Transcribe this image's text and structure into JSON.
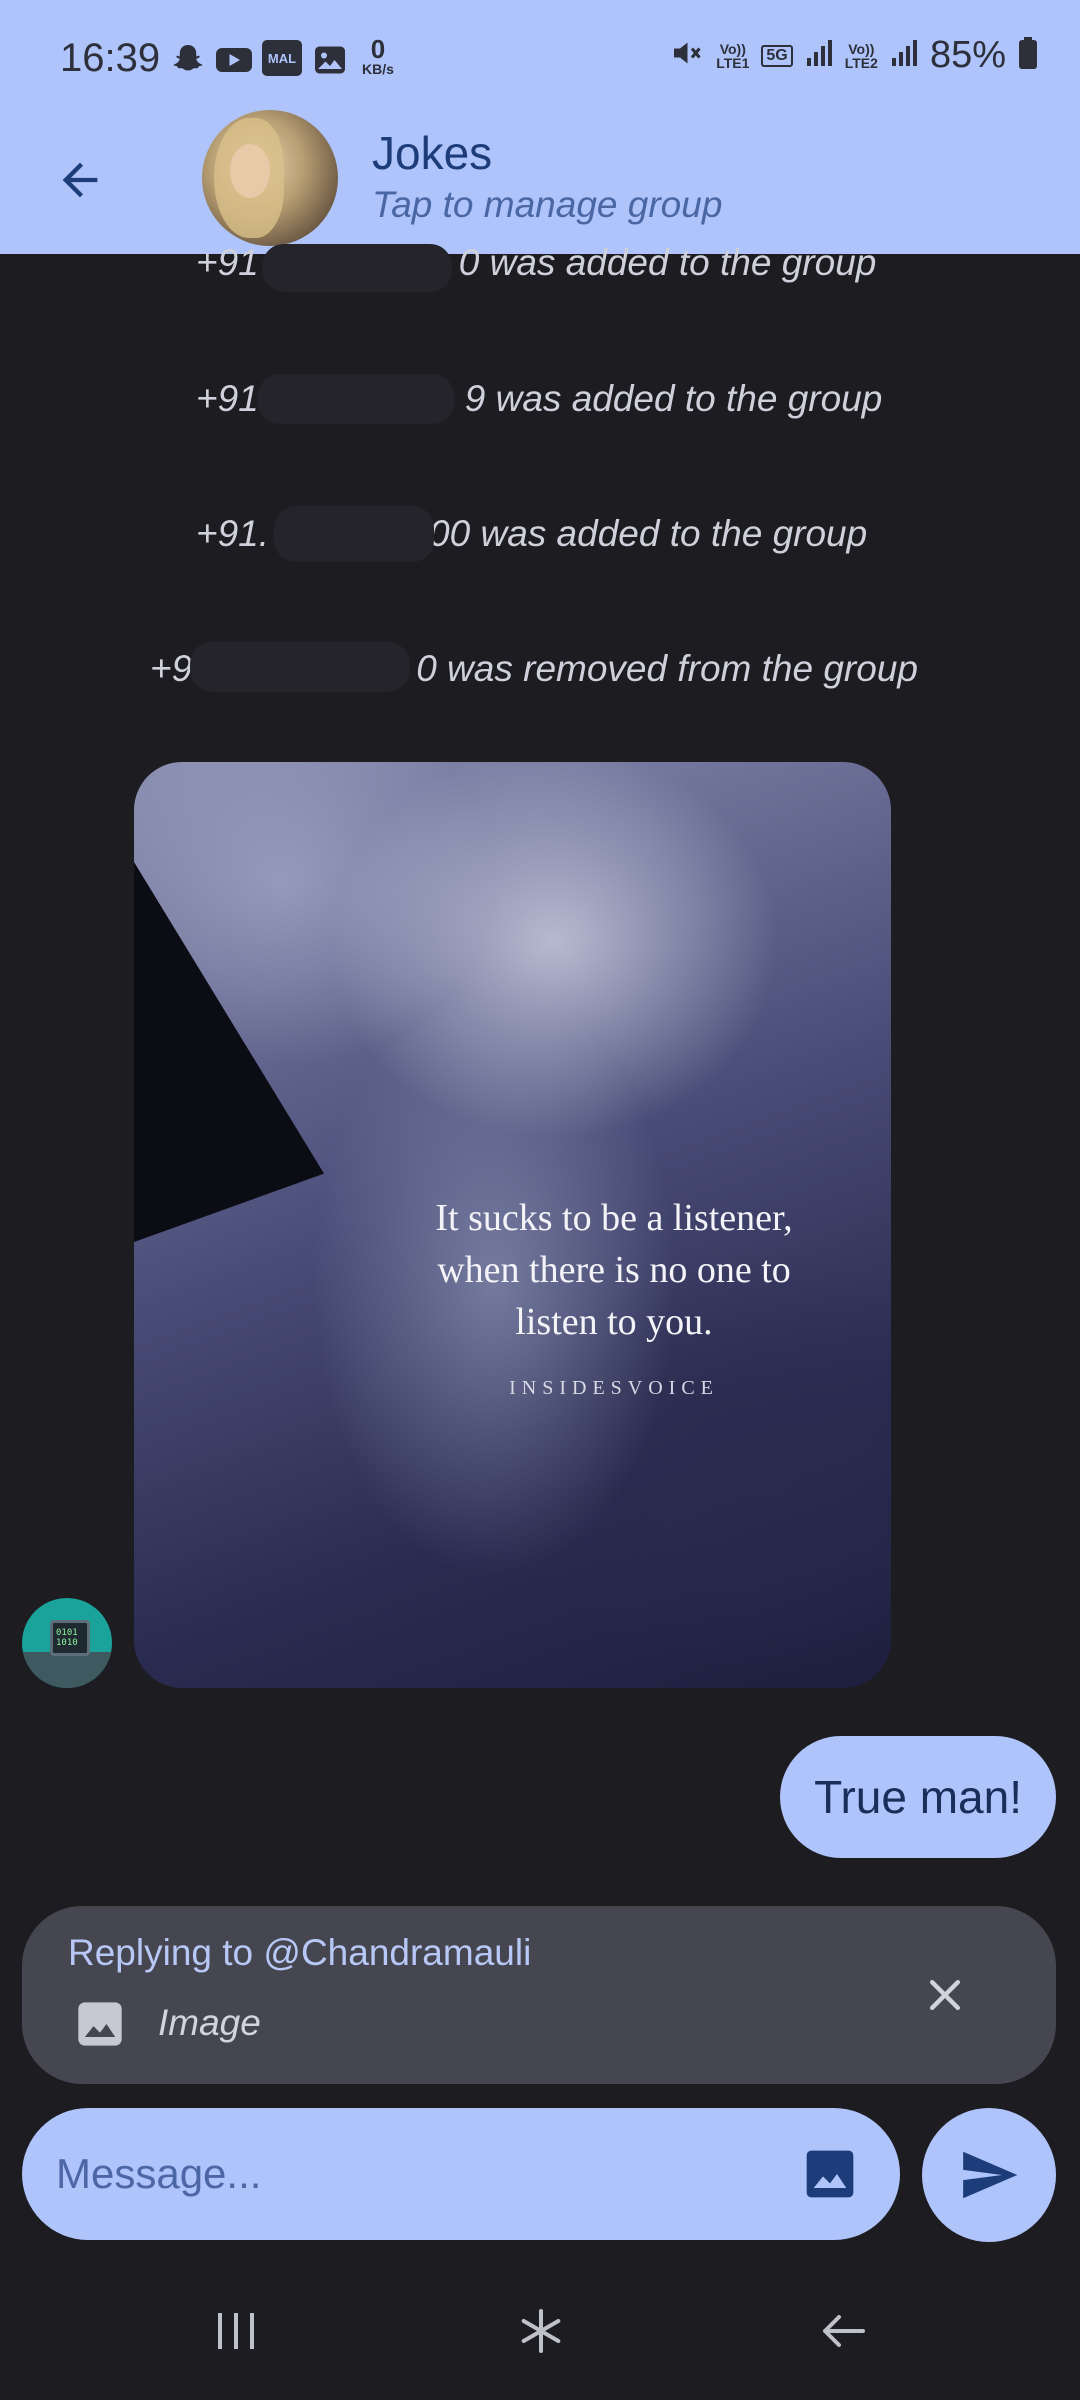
{
  "status_bar": {
    "time": "16:39",
    "net_speed_value": "0",
    "net_speed_unit": "KB/s",
    "sim1_label": "Vo))",
    "sim1_sub": "LTE1",
    "network_type": "5G",
    "sim2_label": "Vo))",
    "sim2_sub": "LTE2",
    "battery": "85%",
    "icons": [
      "snapchat-icon",
      "youtube-icon",
      "mal-icon",
      "gallery-icon",
      "mute-icon",
      "signal-icon",
      "battery-icon"
    ],
    "mal_text": "MAL"
  },
  "header": {
    "title": "Jokes",
    "subtitle": "Tap to manage group",
    "background": "#afc4fb"
  },
  "system_messages": [
    {
      "prefix": "+91",
      "suffix": "0 was added to the group"
    },
    {
      "prefix": "+91",
      "suffix": "9 was added to the group"
    },
    {
      "prefix": "+91.",
      "suffix": "00 was added to the group"
    },
    {
      "prefix": "+9",
      "suffix": "0 was removed from the group"
    }
  ],
  "image_message": {
    "quote": "It sucks to be a listener, when there is no one to listen to you.",
    "quote_line1": "It sucks to be a listener,",
    "quote_line2": "when there is no one to",
    "quote_line3": "listen to you.",
    "watermark": "INSIDESVOICE",
    "sender_avatar_text": "0101 1010"
  },
  "outgoing_message": {
    "text": "True man!"
  },
  "reply_panel": {
    "replying_to": "Replying to @Chandramauli",
    "attachment_label": "Image"
  },
  "composer": {
    "placeholder": "Message...",
    "value": ""
  },
  "colors": {
    "accent": "#afc4fb",
    "background": "#1d1c21",
    "reply_panel": "#45464f"
  }
}
